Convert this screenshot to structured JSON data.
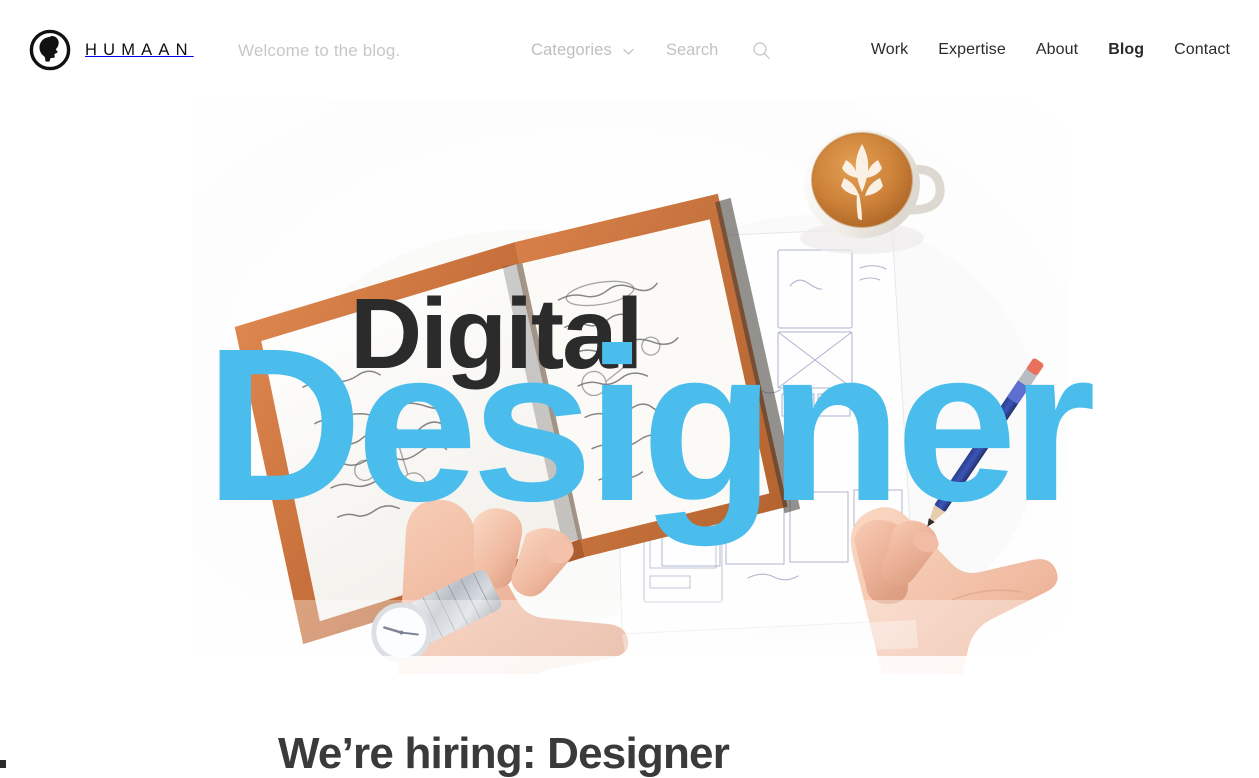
{
  "site": {
    "brand_name": "HUMAAN",
    "logo_icon": "humaan-head-logo",
    "tagline": "Welcome to the blog."
  },
  "header": {
    "categories": {
      "label": "Categories",
      "icon": "chevron-down-icon"
    },
    "search": {
      "placeholder": "Search",
      "value": "",
      "icon": "search-icon"
    },
    "nav_items": [
      {
        "label": "Work",
        "active": false
      },
      {
        "label": "Expertise",
        "active": false
      },
      {
        "label": "About",
        "active": false
      },
      {
        "label": "Blog",
        "active": true
      },
      {
        "label": "Contact",
        "active": false
      }
    ]
  },
  "hero": {
    "title_line_1": "Digital",
    "title_line_2": "Designer",
    "image_alt": "Overhead photo of a desk with an open notebook of handwritten notes, printed wireframe sketches, a latte, and two hands pointing and drawing with a pencil",
    "colors": {
      "accent_blue": "#4ABDEC",
      "headline_dark": "#2b2b2b"
    }
  },
  "post": {
    "title": "We’re hiring: Designer"
  }
}
